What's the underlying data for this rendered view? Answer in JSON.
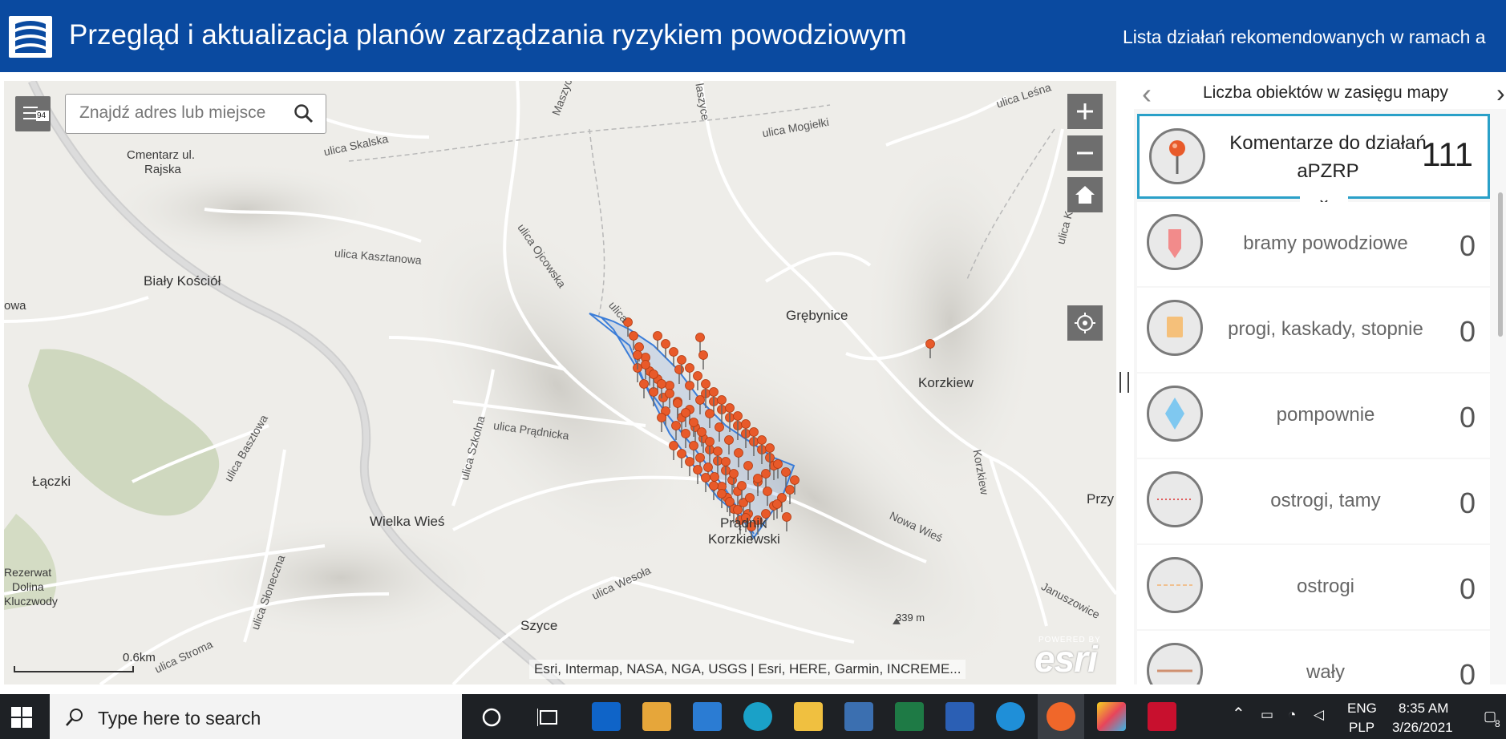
{
  "header": {
    "title": "Przegląd i aktualizacja planów zarządzania ryzykiem powodziowym",
    "link": "Lista działań rekomendowanych w ramach a"
  },
  "map": {
    "layers_badge": "94",
    "search_placeholder": "Znajdź adres lub miejsce",
    "labels": {
      "ulica_lesna": "ulica Leśna",
      "maszyce": "Maszyc",
      "laszyce": "laszyce",
      "ulica_mogielki": "ulica Mogiełki",
      "ulica_skalska": "ulica Skalska",
      "cmentarz": "Cmentarz ul.",
      "rajska": "Rajska",
      "ulica_kasztanowa": "ulica Kasztanowa",
      "ulica_ojcowska": "ulica Ojcowska",
      "ulica_krzem": "ulica Krzem",
      "bialy_kosciol": "Biały Kościół",
      "owa": "owa",
      "grebynice": "Grębynice",
      "korzkiew": "Korzkiew",
      "ulica_pradnicka": "ulica Prądnicka",
      "ulica_basztowa": "ulica Basztowa",
      "ulica_szkolna": "ulica Szkolna",
      "korzkiew_road": "Korzkiew",
      "laczki": "Łączki",
      "wielka_wies": "Wielka Wieś",
      "pradnik": "Prądnik",
      "korzkiewski": "Korzkiewski",
      "nowa_wies": "Nowa Wieś",
      "przy": "Przy",
      "rezerwat": "Rezerwat",
      "dolina": "Dolina",
      "kluczwody": "Kluczwody",
      "ulica_sloneczna": "ulica Słoneczna",
      "ulica_wesola": "ulica Wesoła",
      "szyce": "Szyce",
      "elevation": "339 m",
      "januszowice": "Januszowice",
      "ulica_stroma": "ulica Stroma",
      "ulica_oj_short": "ulica"
    },
    "scale": "0.6km",
    "attribution": "Esri, Intermap, NASA, NGA, USGS | Esri, HERE, Garmin, INCREME...",
    "esri_powered": "POWERED BY",
    "esri_logo": "esri"
  },
  "panel": {
    "title": "Liczba obiektów w zasięgu mapy",
    "items": [
      {
        "label": "Komentarze do działań aPZRP",
        "count": "111",
        "icon": "pin-icon",
        "color": "#e85a2a"
      },
      {
        "label": "bramy powodziowe",
        "count": "0",
        "icon": "flag-marker-icon",
        "color": "#f28b8b"
      },
      {
        "label": "progi, kaskady, stopnie",
        "count": "0",
        "icon": "square-marker-icon",
        "color": "#f5c07a"
      },
      {
        "label": "pompownie",
        "count": "0",
        "icon": "diamond-marker-icon",
        "color": "#7fc8f0"
      },
      {
        "label": "ostrogi, tamy",
        "count": "0",
        "icon": "dotted-line-icon",
        "color": "#e05a5a"
      },
      {
        "label": "ostrogi",
        "count": "0",
        "icon": "dashed-line-icon",
        "color": "#f0c090"
      },
      {
        "label": "wały",
        "count": "0",
        "icon": "line-icon",
        "color": "#d09070"
      }
    ]
  },
  "taskbar": {
    "search_placeholder": "Type here to search",
    "lang1": "ENG",
    "lang2": "PLP",
    "time": "8:35 AM",
    "date": "3/26/2021",
    "notif": "8"
  }
}
